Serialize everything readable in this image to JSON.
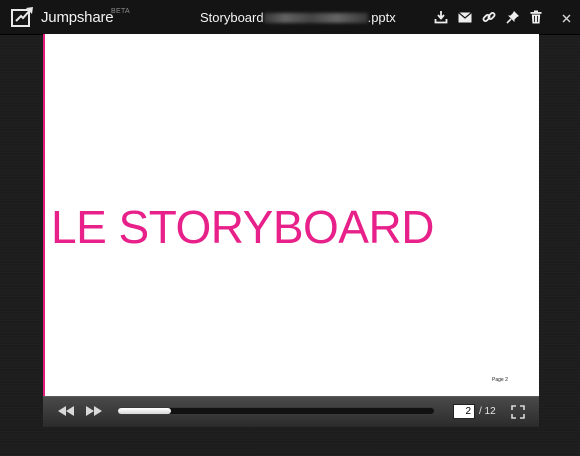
{
  "app": {
    "brand": "Jumpshare",
    "badge": "BETA"
  },
  "header": {
    "file_prefix": "Storyboard",
    "file_suffix": ".pptx",
    "actions": [
      {
        "name": "download-icon"
      },
      {
        "name": "mail-icon"
      },
      {
        "name": "link-icon"
      },
      {
        "name": "pin-icon"
      },
      {
        "name": "trash-icon"
      },
      {
        "name": "close-icon"
      }
    ]
  },
  "slide": {
    "title": "LE STORYBOARD",
    "page_label": "Page 2",
    "title_color": "#e8208a"
  },
  "controls": {
    "current_page": "2",
    "total_pages": "/ 12",
    "progress_fraction": 0.167
  }
}
